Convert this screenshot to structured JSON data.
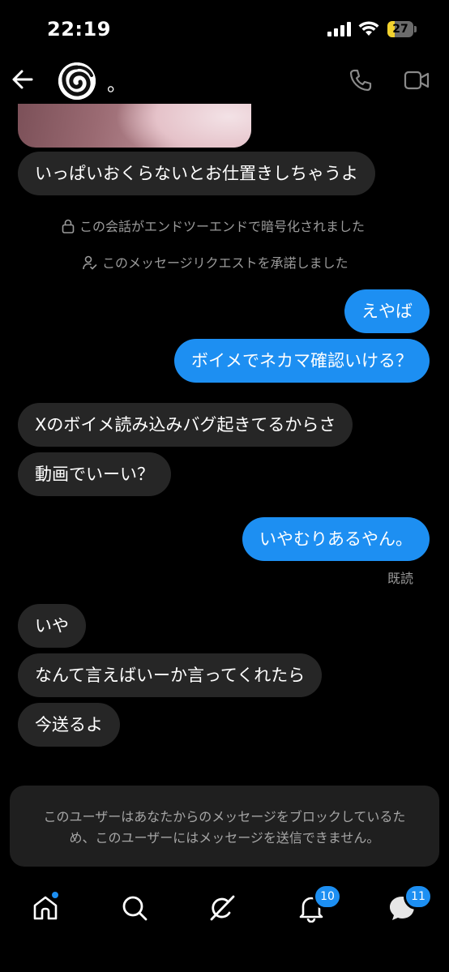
{
  "status_bar": {
    "time": "22:19",
    "battery": "27",
    "battery_level": 0.27
  },
  "header": {
    "contact_name": "。",
    "icons": [
      "back-arrow-icon",
      "phone-icon",
      "video-camera-icon"
    ]
  },
  "messages": [
    {
      "side": "in",
      "text": "いっぱいおくらないとお仕置きしちゃうよ"
    },
    {
      "side": "system",
      "text": "この会話がエンドツーエンドで暗号化されました",
      "icon": "lock-icon"
    },
    {
      "side": "system",
      "text": "このメッセージリクエストを承諾しました",
      "icon": "user-check-icon"
    },
    {
      "side": "out",
      "text": "えやば"
    },
    {
      "side": "out",
      "text": "ボイメでネカマ確認いける？"
    },
    {
      "side": "in",
      "text": "Xのボイメ読み込みバグ起きてるからさ"
    },
    {
      "side": "in",
      "text": "動画でいーい？"
    },
    {
      "side": "out",
      "text": "いやむりあるやん。"
    },
    {
      "side": "in",
      "text": "いや"
    },
    {
      "side": "in",
      "text": "なんて言えばいーか言ってくれたら"
    },
    {
      "side": "in",
      "text": "今送るよ"
    }
  ],
  "read_receipt": "既読",
  "blocked_notice": {
    "line1": "このユーザーはあなたからのメッセージをブロックしているた",
    "line2": "め、このユーザーにはメッセージを送信できません。"
  },
  "bottom_nav": {
    "items": [
      {
        "name": "home",
        "icon": "home-icon"
      },
      {
        "name": "search",
        "icon": "search-icon"
      },
      {
        "name": "grok",
        "icon": "grok-icon"
      },
      {
        "name": "notifications",
        "icon": "bell-icon",
        "badge": "10"
      },
      {
        "name": "messages",
        "icon": "messages-icon",
        "badge": "11"
      }
    ]
  },
  "colors": {
    "background": "#000000",
    "incoming_bubble": "#262626",
    "outgoing_bubble": "#1d8ff2",
    "accent": "#1d8ff2",
    "battery": "#f2d22e"
  }
}
